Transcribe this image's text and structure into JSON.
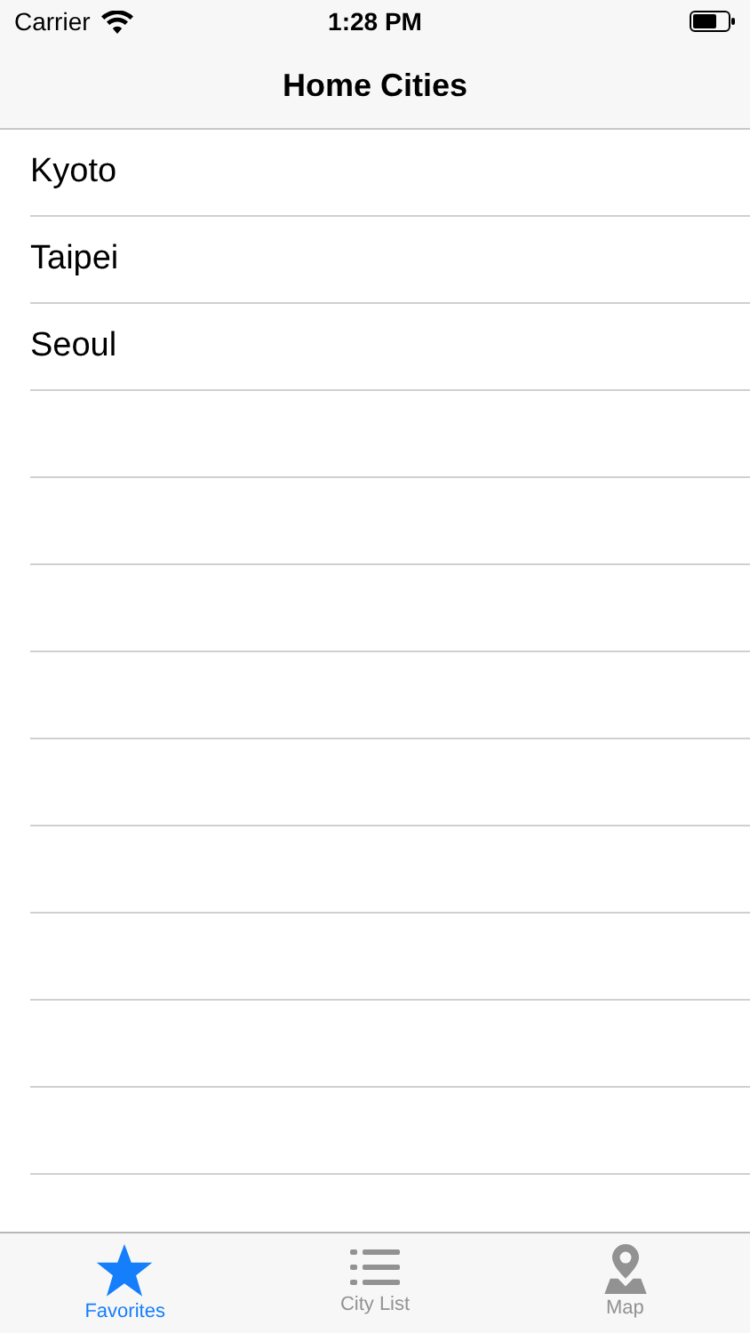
{
  "status_bar": {
    "carrier": "Carrier",
    "time": "1:28 PM"
  },
  "nav_bar": {
    "title": "Home Cities"
  },
  "cities": [
    "Kyoto",
    "Taipei",
    "Seoul"
  ],
  "tabs": [
    {
      "label": "Favorites",
      "kind": "star",
      "selected": true
    },
    {
      "label": "City List",
      "kind": "list",
      "selected": false
    },
    {
      "label": "Map",
      "kind": "map",
      "selected": false
    }
  ]
}
